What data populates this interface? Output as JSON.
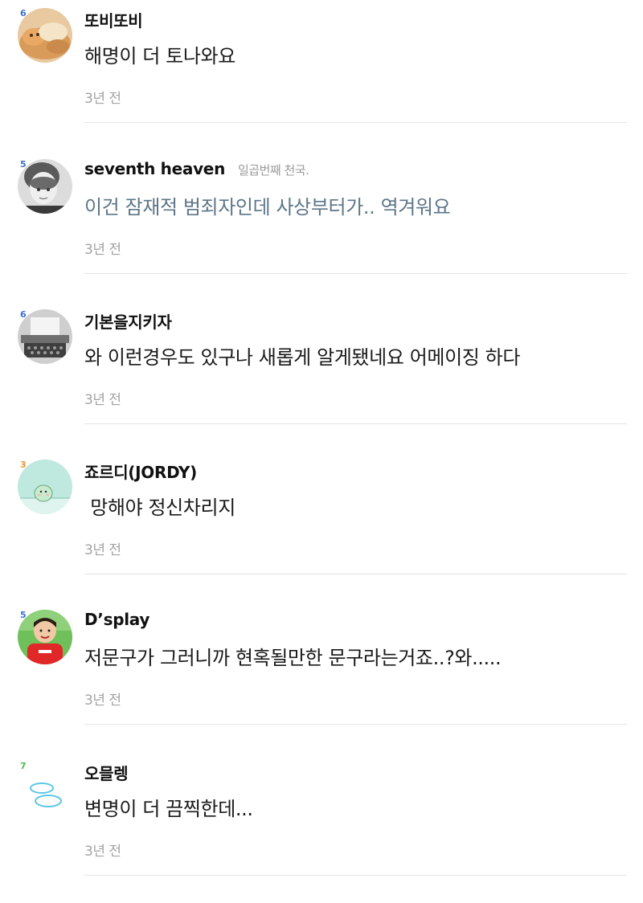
{
  "comments": [
    {
      "nickname": "또비또비",
      "status": "",
      "level": "6",
      "text": "해명이 더 토나와요",
      "time": "3년 전",
      "avatar": "cat-photo-avatar"
    },
    {
      "nickname": "seventh heaven",
      "status": "일곱번째 천국.",
      "level": "5",
      "text": "이건 잠재적 범죄자인데 사상부터가.. 역겨워요",
      "time": "3년 전",
      "avatar": "child-photo-avatar"
    },
    {
      "nickname": "기본을지키자",
      "status": "",
      "level": "6",
      "text": "와 이런경우도 있구나 새롭게 알게됐네요 어메이징 하다",
      "time": "3년 전",
      "avatar": "typewriter-photo-avatar"
    },
    {
      "nickname": "죠르디(JORDY)",
      "status": "",
      "level": "3",
      "text": " 망해야 정신차리지",
      "time": "3년 전",
      "avatar": "jordy-character-avatar"
    },
    {
      "nickname": "D’splay",
      "status": "",
      "level": "5",
      "text": "저문구가 그러니까 현혹될만한 문구라는거죠..?와.....",
      "time": "3년 전",
      "avatar": "kid-red-shirt-avatar"
    },
    {
      "nickname": "오믈렝",
      "status": "",
      "level": "7",
      "text": "변명이 더 끔찍한데...",
      "time": "3년 전",
      "avatar": "rings-avatar"
    }
  ],
  "colors": {
    "level_blue": "#3d6fd1",
    "level_orange": "#f0932e",
    "level_green": "#4cbf4c",
    "colored_text": "#5d7688",
    "time_gray": "#a3a3a3",
    "divider": "#e4e4e4"
  }
}
